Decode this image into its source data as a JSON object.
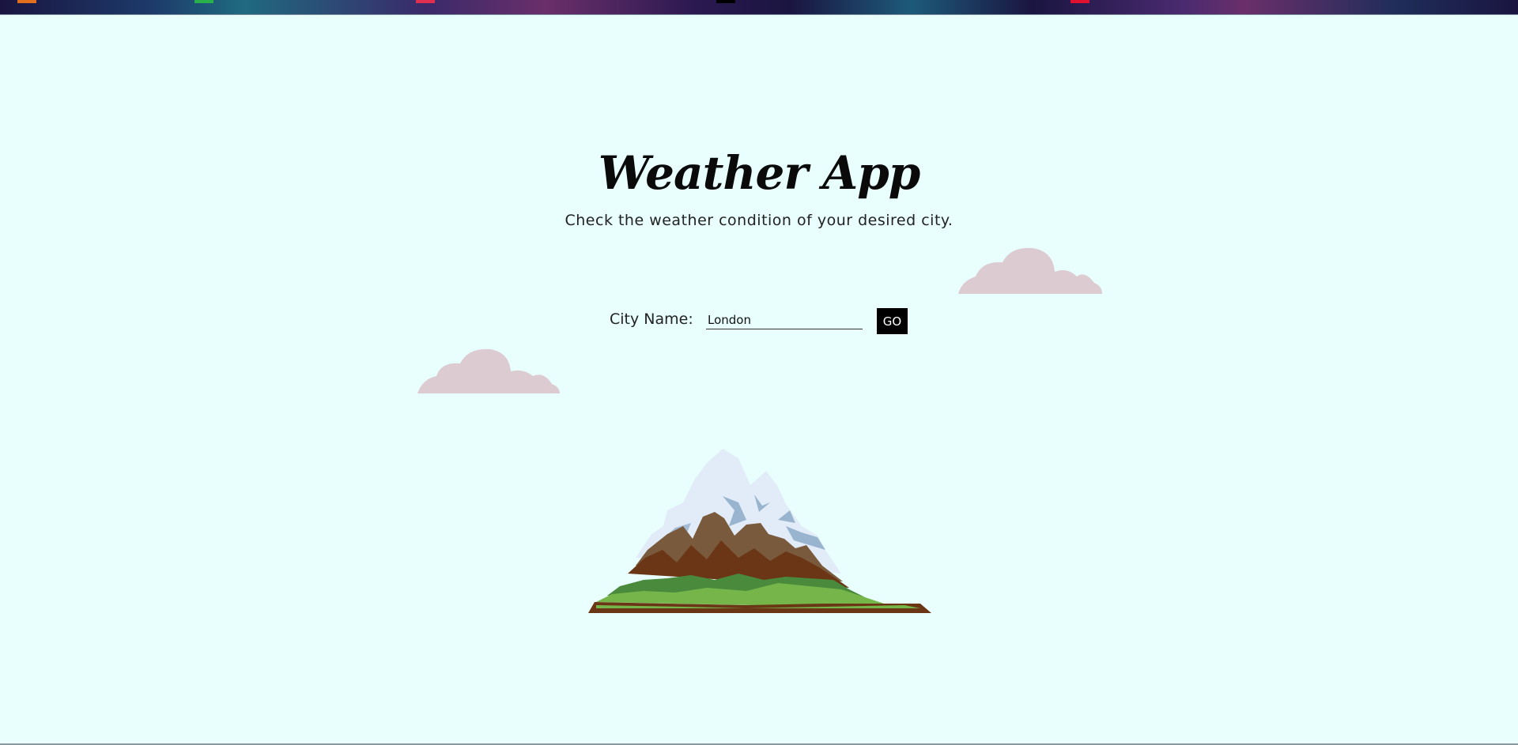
{
  "app": {
    "title": "Weather App",
    "subtitle": "Check the weather condition of your desired city."
  },
  "search": {
    "label": "City Name:",
    "value": "London",
    "go_label": "GO"
  },
  "colors": {
    "background": "#e8fffe",
    "cloud": "#dccbd1",
    "button": "#000000"
  },
  "icons": {
    "cloud_left": "cloud-icon",
    "cloud_right": "cloud-icon",
    "mountain": "mountain-illustration"
  }
}
